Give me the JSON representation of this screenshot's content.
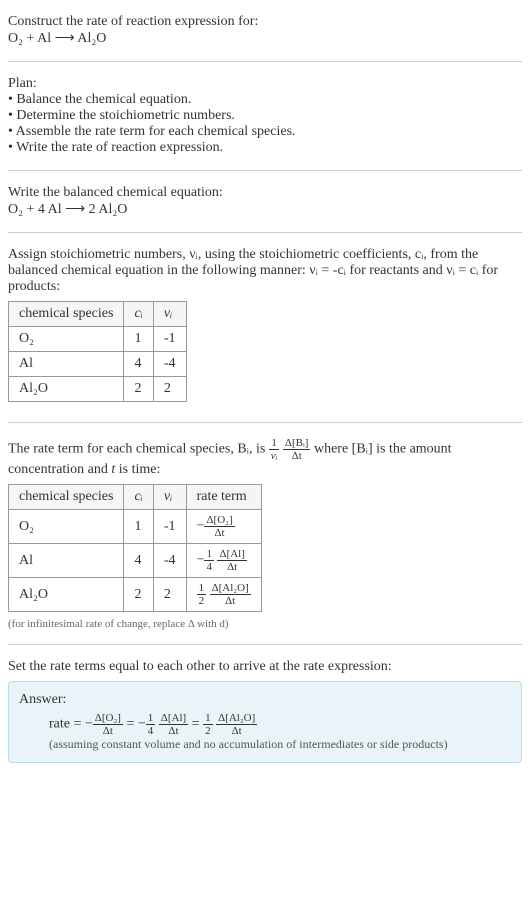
{
  "prompt": {
    "line1": "Construct the rate of reaction expression for:",
    "equation": "O₂ + Al ⟶ Al₂O"
  },
  "plan": {
    "title": "Plan:",
    "items": [
      "Balance the chemical equation.",
      "Determine the stoichiometric numbers.",
      "Assemble the rate term for each chemical species.",
      "Write the rate of reaction expression."
    ]
  },
  "balanced": {
    "title": "Write the balanced chemical equation:",
    "equation": "O₂ + 4 Al ⟶ 2 Al₂O"
  },
  "stoich": {
    "intro1": "Assign stoichiometric numbers, νᵢ, using the stoichiometric coefficients, cᵢ, from the balanced chemical equation in the following manner: νᵢ = -cᵢ for reactants and νᵢ = cᵢ for products:",
    "headers": [
      "chemical species",
      "cᵢ",
      "νᵢ"
    ],
    "rows": [
      {
        "species": "O₂",
        "c": "1",
        "v": "-1"
      },
      {
        "species": "Al",
        "c": "4",
        "v": "-4"
      },
      {
        "species": "Al₂O",
        "c": "2",
        "v": "2"
      }
    ]
  },
  "rateterm": {
    "intro_a": "The rate term for each chemical species, Bᵢ, is ",
    "intro_b": " where [Bᵢ] is the amount concentration and ",
    "intro_c": "t",
    "intro_d": " is time:",
    "frac1_num": "1",
    "frac1_den": "νᵢ",
    "frac2_num": "Δ[Bᵢ]",
    "frac2_den": "Δt",
    "headers": [
      "chemical species",
      "cᵢ",
      "νᵢ",
      "rate term"
    ],
    "rows": [
      {
        "species": "O₂",
        "c": "1",
        "v": "-1",
        "rate_prefix": "−",
        "rate_num": "Δ[O₂]",
        "rate_den": "Δt",
        "coef_num": "",
        "coef_den": ""
      },
      {
        "species": "Al",
        "c": "4",
        "v": "-4",
        "rate_prefix": "−",
        "rate_num": "Δ[Al]",
        "rate_den": "Δt",
        "coef_num": "1",
        "coef_den": "4"
      },
      {
        "species": "Al₂O",
        "c": "2",
        "v": "2",
        "rate_prefix": "",
        "rate_num": "Δ[Al₂O]",
        "rate_den": "Δt",
        "coef_num": "1",
        "coef_den": "2"
      }
    ],
    "footnote": "(for infinitesimal rate of change, replace Δ with d)"
  },
  "final": {
    "title": "Set the rate terms equal to each other to arrive at the rate expression:",
    "answer_label": "Answer:",
    "rate_prefix": "rate = −",
    "t1_num": "Δ[O₂]",
    "t1_den": "Δt",
    "eq1": " = −",
    "c2_num": "1",
    "c2_den": "4",
    "t2_num": "Δ[Al]",
    "t2_den": "Δt",
    "eq2": " = ",
    "c3_num": "1",
    "c3_den": "2",
    "t3_num": "Δ[Al₂O]",
    "t3_den": "Δt",
    "note": "(assuming constant volume and no accumulation of intermediates or side products)"
  },
  "chart_data": {
    "type": "table",
    "tables": [
      {
        "title": "Stoichiometric numbers",
        "columns": [
          "chemical species",
          "c_i",
          "ν_i"
        ],
        "rows": [
          [
            "O2",
            1,
            -1
          ],
          [
            "Al",
            4,
            -4
          ],
          [
            "Al2O",
            2,
            2
          ]
        ]
      },
      {
        "title": "Rate terms",
        "columns": [
          "chemical species",
          "c_i",
          "ν_i",
          "rate term"
        ],
        "rows": [
          [
            "O2",
            1,
            -1,
            "-Δ[O2]/Δt"
          ],
          [
            "Al",
            4,
            -4,
            "-(1/4) Δ[Al]/Δt"
          ],
          [
            "Al2O",
            2,
            2,
            "(1/2) Δ[Al2O]/Δt"
          ]
        ]
      }
    ]
  }
}
